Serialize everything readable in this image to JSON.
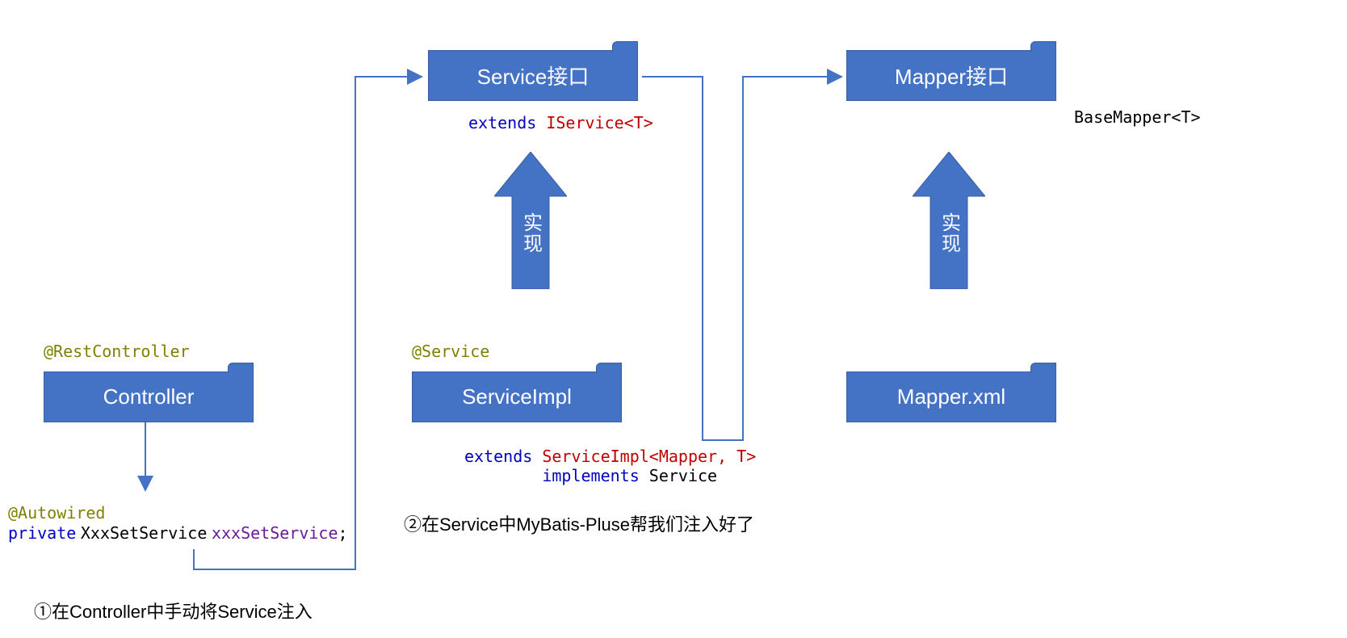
{
  "boxes": {
    "controller": "Controller",
    "serviceInterface": "Service接口",
    "mapperInterface": "Mapper接口",
    "serviceImpl": "ServiceImpl",
    "mapperXml": "Mapper.xml"
  },
  "annotations": {
    "restController": "@RestController",
    "service": "@Service",
    "autowired": "@Autowired"
  },
  "code": {
    "extends1": "extends",
    "iservice": "IService<T>",
    "extends2": "extends",
    "serviceImplMapper": "ServiceImpl<Mapper, T>",
    "implements": "implements",
    "serviceWord": "Service",
    "baseMapper": "BaseMapper<T>",
    "privateKw": "private",
    "typeName": "XxxSetService",
    "varName": "xxxSetService",
    "semicolon": ";"
  },
  "arrowLabel": "实现",
  "notes": {
    "note1": "①在Controller中手动将Service注入",
    "note2": "②在Service中MyBatis-Pluse帮我们注入好了"
  }
}
